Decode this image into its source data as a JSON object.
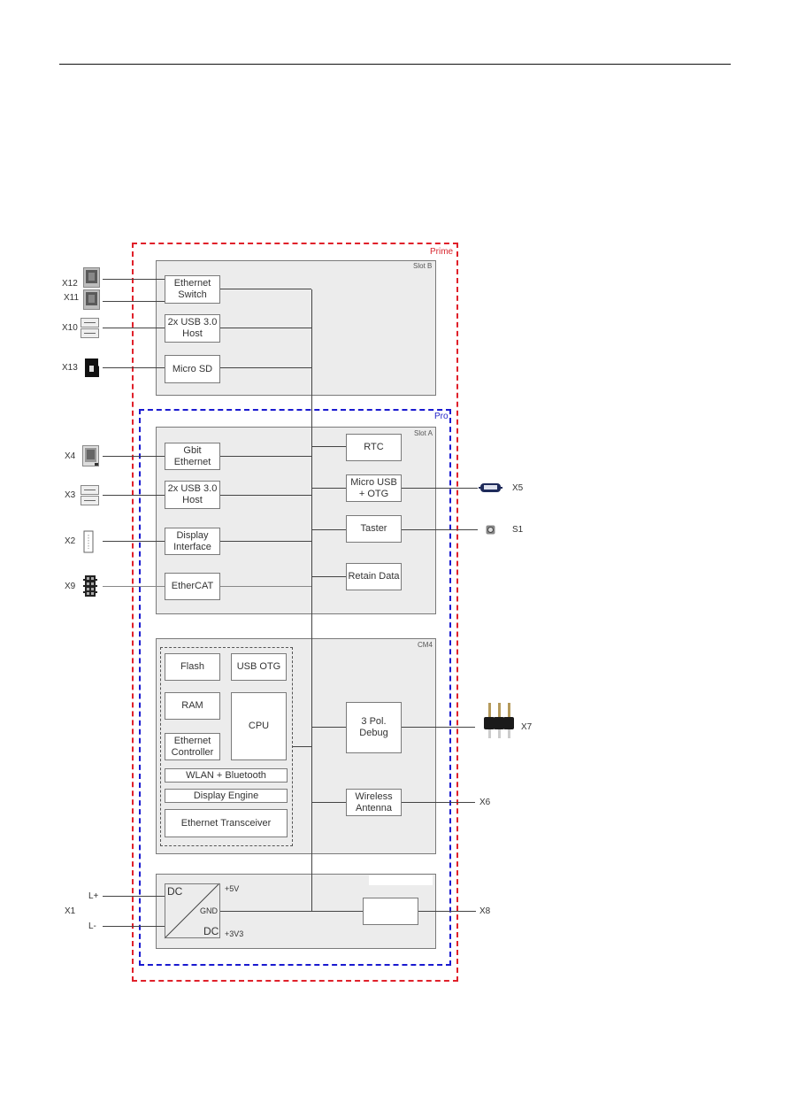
{
  "zones": {
    "prime": "Prime",
    "pro": "Pro"
  },
  "slots": {
    "slot_b": "Slot B",
    "slot_a": "Slot A",
    "cm4": "CM4",
    "power": ""
  },
  "slot_b_blocks": {
    "ethernet_switch": "Ethernet\nSwitch",
    "usb_host": "2x USB 3.0\nHost",
    "micro_sd": "Micro SD"
  },
  "slot_a_blocks": {
    "gbit_ethernet": "Gbit\nEthernet",
    "usb_host": "2x USB 3.0\nHost",
    "display_interface": "Display\nInterface",
    "ethercat": "EtherCAT",
    "rtc": "RTC",
    "micro_usb_otg": "Micro USB\n+ OTG",
    "taster": "Taster",
    "retain_data": "Retain Data"
  },
  "cm4_blocks": {
    "flash": "Flash",
    "usb_otg": "USB OTG",
    "ram": "RAM",
    "cpu": "CPU",
    "ethernet_controller": "Ethernet\nController",
    "wlan_bluetooth": "WLAN + Bluetooth",
    "display_engine": "Display Engine",
    "ethernet_transceiver": "Ethernet Transceiver",
    "debug": "3 Pol.\nDebug",
    "wireless_antenna": "Wireless\nAntenna"
  },
  "power": {
    "dc_top": "DC",
    "dc_bottom": "DC",
    "gnd": "GND",
    "v5": "+5V",
    "v3v3": "+3V3",
    "x8_block": ""
  },
  "connectors": {
    "x12": "X12",
    "x11": "X11",
    "x10": "X10",
    "x13": "X13",
    "x4": "X4",
    "x3": "X3",
    "x2": "X2",
    "x9": "X9",
    "x5": "X5",
    "s1": "S1",
    "x7": "X7",
    "x6": "X6",
    "x1": "X1",
    "l_plus": "L+",
    "l_minus": "L-",
    "x8": "X8"
  },
  "colors": {
    "prime_border": "#e0202a",
    "pro_border": "#1a1ad0",
    "slot_fill": "#ececec"
  }
}
